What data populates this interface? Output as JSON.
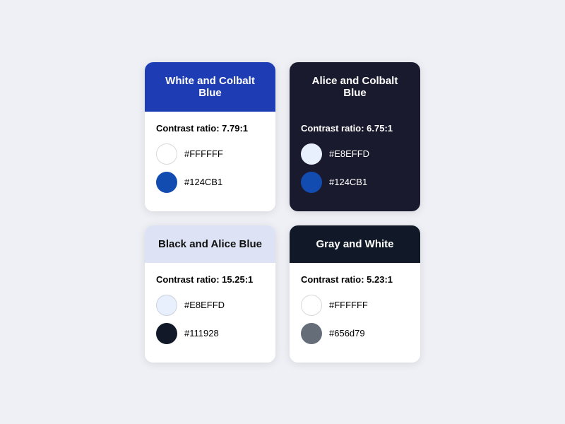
{
  "cards": [
    {
      "id": "card-1",
      "title": "White and Colbalt Blue",
      "contrast_label": "Contrast ratio: 7.79:1",
      "bg_class": "card-1",
      "colors": [
        {
          "swatch": "#FFFFFF",
          "label": "#FFFFFF",
          "border": "rgba(0,0,0,0.15)"
        },
        {
          "swatch": "#124CB1",
          "label": "#124CB1",
          "border": "transparent"
        }
      ],
      "dark_body": false
    },
    {
      "id": "card-2",
      "title": "Alice and Colbalt Blue",
      "contrast_label": "Contrast ratio: 6.75:1",
      "bg_class": "card-2",
      "colors": [
        {
          "swatch": "#E8EFFD",
          "label": "#E8EFFD",
          "border": "rgba(255,255,255,0.2)"
        },
        {
          "swatch": "#124CB1",
          "label": "#124CB1",
          "border": "transparent"
        }
      ],
      "dark_body": true
    },
    {
      "id": "card-3",
      "title": "Black and Alice Blue",
      "contrast_label": "Contrast ratio: 15.25:1",
      "bg_class": "card-3",
      "colors": [
        {
          "swatch": "#E8EFFD",
          "label": "#E8EFFD",
          "border": "rgba(0,0,0,0.12)"
        },
        {
          "swatch": "#111928",
          "label": "#111928",
          "border": "transparent"
        }
      ],
      "dark_body": false
    },
    {
      "id": "card-4",
      "title": "Gray and White",
      "contrast_label": "Contrast ratio: 5.23:1",
      "bg_class": "card-4",
      "colors": [
        {
          "swatch": "#FFFFFF",
          "label": "#FFFFFF",
          "border": "rgba(0,0,0,0.15)"
        },
        {
          "swatch": "#656d79",
          "label": "#656d79",
          "border": "transparent"
        }
      ],
      "dark_body": false
    }
  ]
}
